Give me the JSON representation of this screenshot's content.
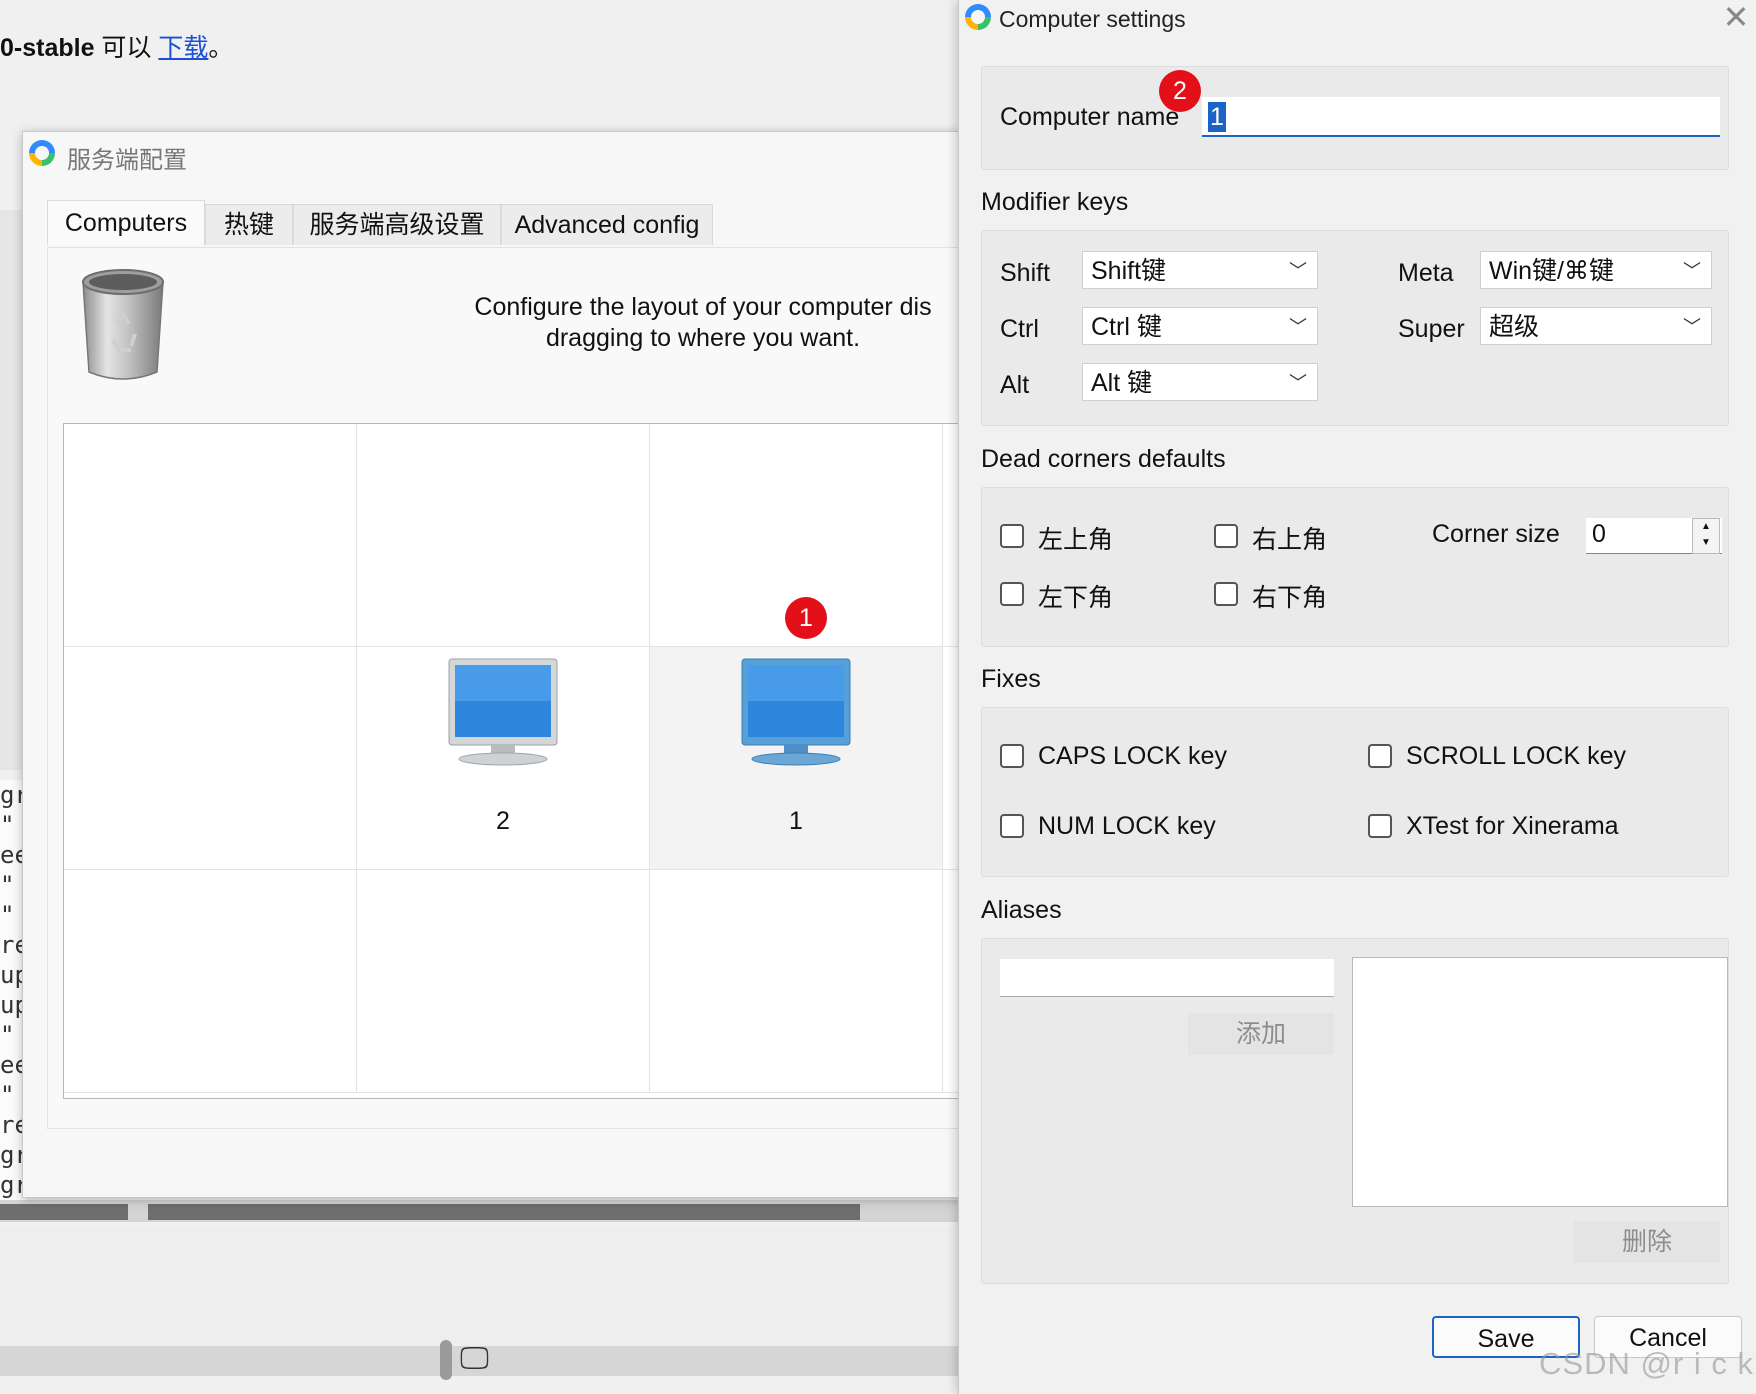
{
  "background_page": {
    "text_bold": "0-stable",
    "text_middle": " 可以 ",
    "link": "下载",
    "text_end": "。",
    "code_lines": [
      "gr",
      " \"",
      "ee",
      " \"",
      " \"",
      "re",
      "up",
      "up",
      " \"",
      "ee",
      " \"",
      "re",
      "gr",
      "gr"
    ]
  },
  "server_window": {
    "title": "服务端配置",
    "tabs": [
      "Computers",
      "热键",
      "服务端高级设置",
      "Advanced config"
    ],
    "description": "Configure the layout of your computer dis\ndragging to where you want.",
    "computers": [
      {
        "label": "2"
      },
      {
        "label": "1"
      }
    ],
    "badge_1": "1"
  },
  "settings_dialog": {
    "title": "Computer settings",
    "computer_name_label": "Computer name",
    "computer_name_value": "1",
    "badge_2": "2",
    "modifier_keys_title": "Modifier keys",
    "modifiers": {
      "shift_label": "Shift",
      "shift_value": "Shift键",
      "ctrl_label": "Ctrl",
      "ctrl_value": "Ctrl 键",
      "alt_label": "Alt",
      "alt_value": "Alt 键",
      "meta_label": "Meta",
      "meta_value": "Win键/⌘键",
      "super_label": "Super",
      "super_value": "超级"
    },
    "dead_corners_title": "Dead corners defaults",
    "dead_corners": {
      "top_left": "左上角",
      "top_right": "右上角",
      "bottom_left": "左下角",
      "bottom_right": "右下角",
      "corner_size_label": "Corner size",
      "corner_size_value": "0"
    },
    "fixes_title": "Fixes",
    "fixes": {
      "caps_lock": "CAPS LOCK key",
      "scroll_lock": "SCROLL LOCK key",
      "num_lock": "NUM LOCK key",
      "xtest": "XTest for Xinerama"
    },
    "aliases_title": "Aliases",
    "aliases": {
      "add_button": "添加",
      "remove_button": "删除"
    },
    "save_button": "Save",
    "cancel_button": "Cancel"
  },
  "watermark": "CSDN @r i c k",
  "colors": {
    "badge_red": "#e3101a",
    "selection_blue": "#1b63c6",
    "link_blue": "#1a4fd6"
  }
}
